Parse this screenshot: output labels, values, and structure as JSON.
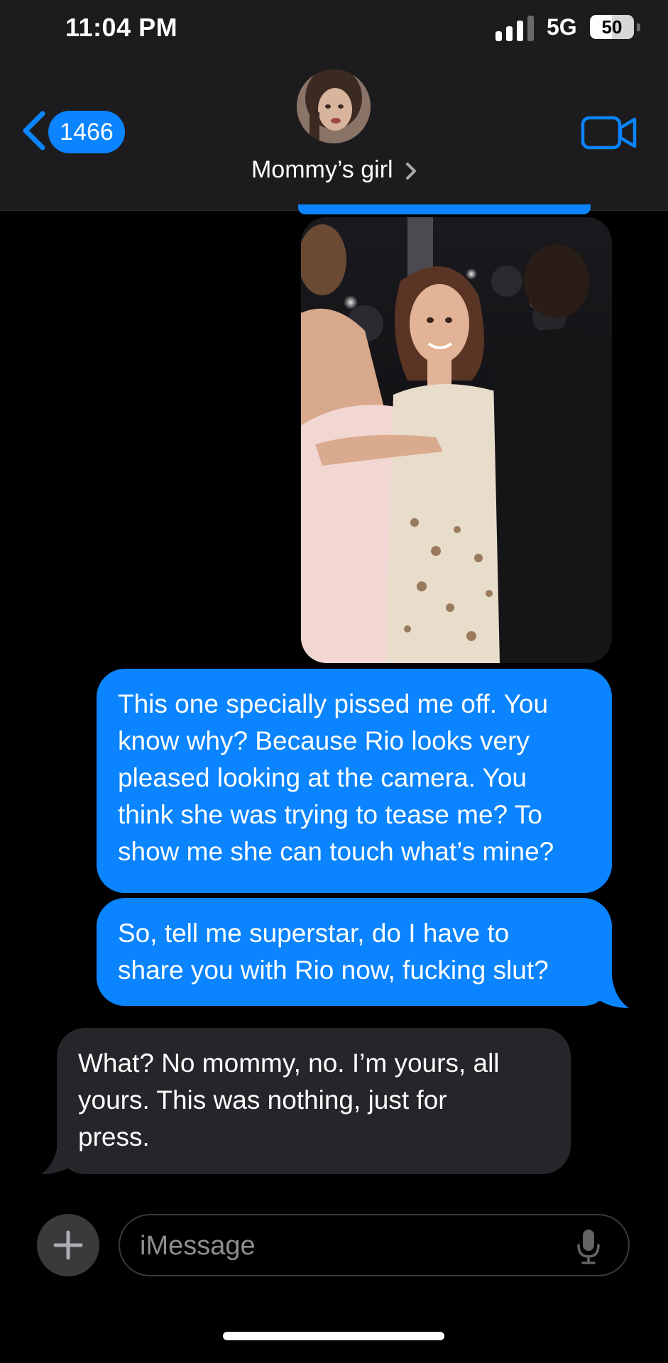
{
  "status_bar": {
    "time": "11:04 PM",
    "network": "5G",
    "battery_percent": "50",
    "battery_level": 0.5,
    "signal_bars": 3
  },
  "header": {
    "back_count": "1466",
    "contact_name": "Mommy’s girl",
    "icons": [
      "back-chevron-icon",
      "contact-avatar",
      "chevron-right-icon",
      "video-camera-icon"
    ],
    "accent_color": "#0a84ff"
  },
  "messages": [
    {
      "from": "me",
      "type": "photo",
      "description_icon": "photo-attachment"
    },
    {
      "from": "me",
      "type": "text",
      "text": "This one specially pissed me off. You\nknow why? Because Rio looks very\npleased looking at the camera. You\nthink she was trying to tease me? To\nshow me she can touch what’s mine?"
    },
    {
      "from": "me",
      "type": "text",
      "text": "So, tell me superstar, do I have to\nshare you with Rio now, fucking slut?"
    },
    {
      "from": "them",
      "type": "text",
      "text": "What? No mommy, no. I’m yours, all\nyours. This was nothing, just for\npress."
    }
  ],
  "compose": {
    "placeholder": "iMessage",
    "icons": [
      "plus-icon",
      "microphone-icon"
    ]
  },
  "colors": {
    "outgoing_bubble": "#0a84ff",
    "incoming_bubble": "#26252a",
    "background": "#000000",
    "header_background": "#1c1c1e"
  }
}
